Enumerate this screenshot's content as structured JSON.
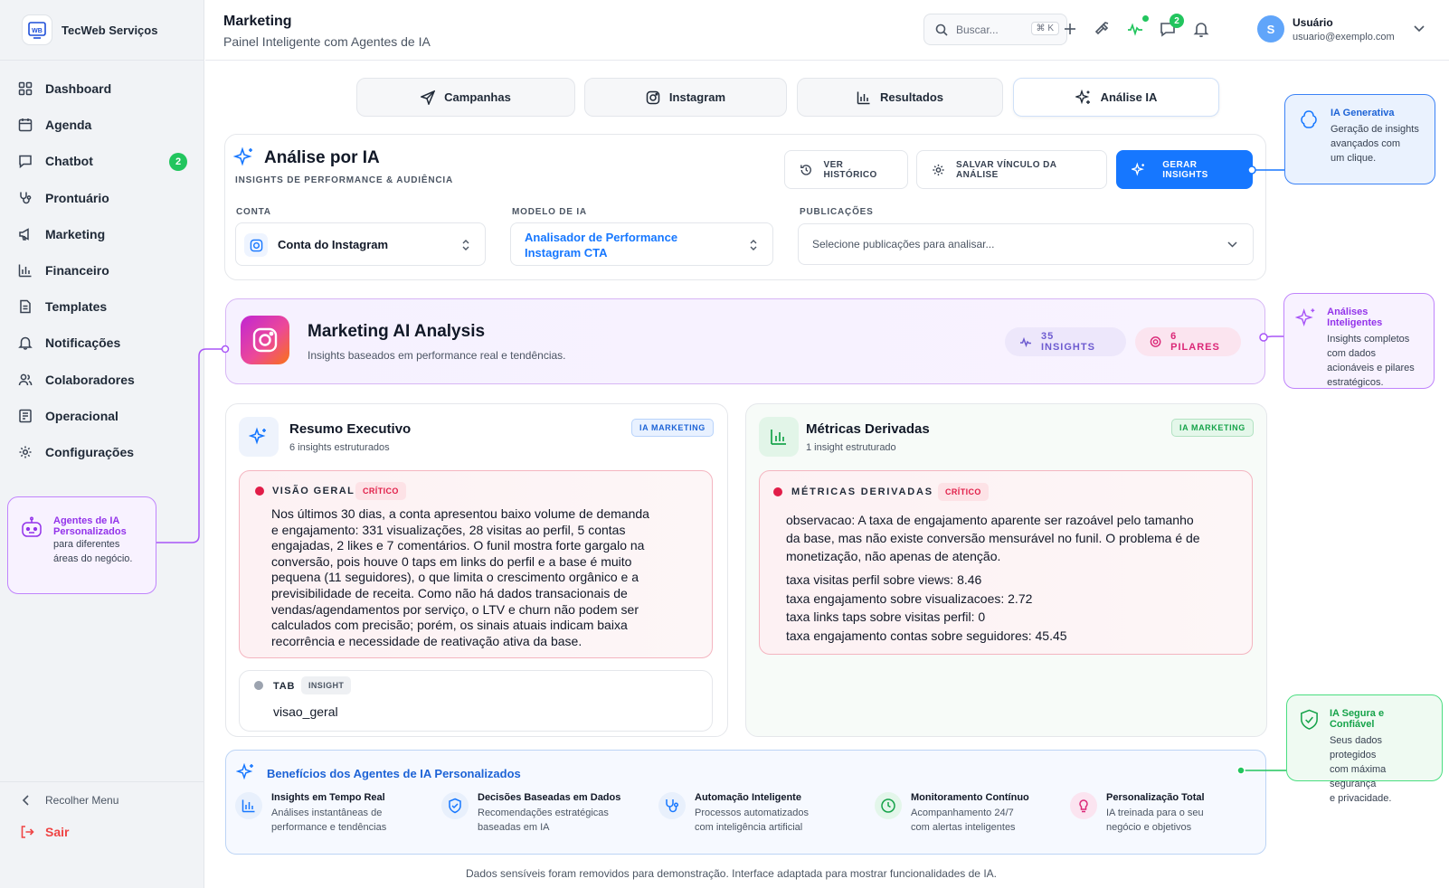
{
  "brand": {
    "name": "TecWeb Serviços"
  },
  "sidebar": {
    "items": [
      {
        "label": "Dashboard",
        "icon": "grid-icon"
      },
      {
        "label": "Agenda",
        "icon": "calendar-icon"
      },
      {
        "label": "Chatbot",
        "icon": "chat-icon",
        "badge": "2"
      },
      {
        "label": "Prontuário",
        "icon": "stethoscope-icon"
      },
      {
        "label": "Marketing",
        "icon": "megaphone-icon"
      },
      {
        "label": "Financeiro",
        "icon": "bar-chart-icon"
      },
      {
        "label": "Templates",
        "icon": "document-icon"
      },
      {
        "label": "Notificações",
        "icon": "bell-icon"
      },
      {
        "label": "Colaboradores",
        "icon": "users-icon"
      },
      {
        "label": "Operacional",
        "icon": "clipboard-icon"
      },
      {
        "label": "Configurações",
        "icon": "gear-icon"
      }
    ],
    "collapse": "Recolher Menu",
    "logout": "Sair"
  },
  "header": {
    "title": "Marketing",
    "subtitle": "Painel Inteligente com Agentes de IA",
    "search_placeholder": "Buscar...",
    "search_shortcut": "⌘ K",
    "chat_badge": "2",
    "user_name": "Usuário",
    "user_email": "usuario@exemplo.com",
    "avatar_initial": "S"
  },
  "tabs": [
    {
      "label": "Campanhas",
      "icon": "send-icon"
    },
    {
      "label": "Instagram",
      "icon": "instagram-icon"
    },
    {
      "label": "Resultados",
      "icon": "bar-chart-icon"
    },
    {
      "label": "Análise IA",
      "icon": "sparkles-icon",
      "active": true
    }
  ],
  "analysis": {
    "title": "Análise por IA",
    "subtitle": "INSIGHTS DE PERFORMANCE & AUDIÊNCIA",
    "btn_history": "VER HISTÓRICO",
    "btn_save": "SALVAR VÍNCULO DA ANÁLISE",
    "btn_generate": "GERAR INSIGHTS",
    "account_label": "CONTA",
    "account_value": "Conta do Instagram",
    "model_label": "MODELO DE IA",
    "model_value_line1": "Analisador de Performance",
    "model_value_line2": "Instagram CTA",
    "posts_label": "PUBLICAÇÕES",
    "posts_placeholder": "Selecione publicações para analisar..."
  },
  "banner": {
    "title": "Marketing AI Analysis",
    "subtitle": "Insights baseados em performance real e tendências.",
    "insights_pill": "35 INSIGHTS",
    "pillars_pill": "6 PILARES"
  },
  "summary_card": {
    "title": "Resumo Executivo",
    "count": "6 insights estruturados",
    "chip": "IA MARKETING",
    "alert_title": "VISÃO GERAL",
    "alert_chip": "CRÍTICO",
    "alert_lines": [
      "Nos últimos 30 dias, a conta apresentou baixo volume de demanda",
      "e engajamento: 331 visualizações, 28 visitas ao perfil, 5 contas",
      "engajadas, 2 likes e 7 comentários. O funil mostra forte gargalo na",
      "conversão, pois houve 0 taps em links do perfil e a base é muito",
      "pequena (11 seguidores), o que limita o crescimento orgânico e a",
      "previsibilidade de receita. Como não há dados transacionais de",
      "vendas/agendamentos por serviço, o LTV e churn não podem ser",
      "calculados com precisão; porém, os sinais atuais indicam baixa",
      "recorrência e necessidade de reativação ativa da base."
    ],
    "tab_title": "TAB",
    "tab_chip": "INSIGHT",
    "tab_value": "visao_geral"
  },
  "metrics_card": {
    "title": "Métricas Derivadas",
    "count": "1 insight estruturado",
    "chip": "IA MARKETING",
    "alert_title": "MÉTRICAS DERIVADAS",
    "alert_chip": "CRÍTICO",
    "obs_lines": [
      "observacao: A taxa de engajamento aparente ser razoável pelo tamanho",
      "da base, mas não existe conversão mensurável no funil. O problema é de",
      "monetização, não apenas de atenção."
    ],
    "metrics": [
      "taxa visitas perfil sobre views: 8.46",
      "taxa engajamento sobre visualizacoes: 2.72",
      "taxa links taps sobre visitas perfil: 0",
      "taxa engajamento contas sobre seguidores: 45.45"
    ]
  },
  "benefits": {
    "title": "Benefícios dos Agentes de IA Personalizados",
    "items": [
      {
        "title": "Insights em Tempo Real",
        "line1": "Análises instantâneas de",
        "line2": "performance e tendências"
      },
      {
        "title": "Decisões Baseadas em Dados",
        "line1": "Recomendações estratégicas",
        "line2": "baseadas em IA"
      },
      {
        "title": "Automação Inteligente",
        "line1": "Processos automatizados",
        "line2": "com inteligência artificial"
      },
      {
        "title": "Monitoramento Contínuo",
        "line1": "Acompanhamento 24/7",
        "line2": "com alertas inteligentes"
      },
      {
        "title": "Personalização Total",
        "line1": "IA treinada para o seu",
        "line2": "negócio e objetivos"
      }
    ]
  },
  "footer_note": "Dados sensíveis foram removidos para demonstração. Interface adaptada para mostrar funcionalidades de IA.",
  "callouts": {
    "generativa": {
      "title": "IA Generativa",
      "l1": "Geração de insights",
      "l2": "avançados com",
      "l3": "um clique."
    },
    "analises": {
      "title": "Análises Inteligentes",
      "l1": "Insights completos",
      "l2": "com dados",
      "l3": "acionáveis e pilares",
      "l4": "estratégicos."
    },
    "agentes": {
      "title1": "Agentes de IA",
      "title2": "Personalizados",
      "l1": "para diferentes",
      "l2": "áreas do negócio."
    },
    "segura": {
      "title": "IA Segura e Confiável",
      "l1": "Seus dados protegidos",
      "l2": "com máxima segurança",
      "l3": "e privacidade."
    }
  },
  "colors": {
    "primary": "#1677ff",
    "success": "#22c55e",
    "critical": "#ef4444",
    "purple": "#a855f7"
  }
}
